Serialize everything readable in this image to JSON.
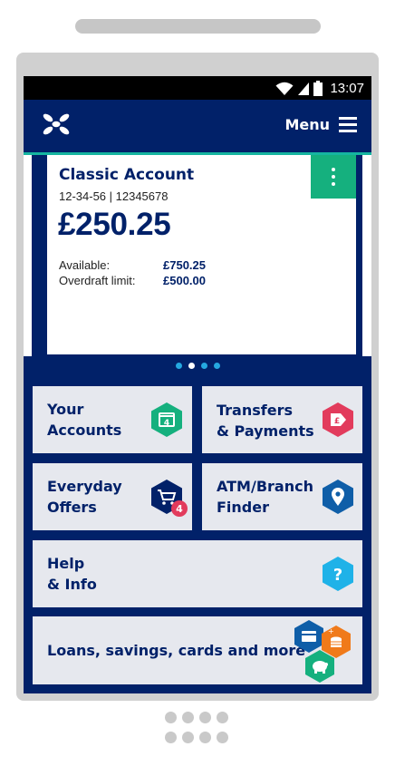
{
  "status_bar": {
    "time": "13:07"
  },
  "header": {
    "menu_label": "Menu"
  },
  "account_card": {
    "name": "Classic Account",
    "sort_and_number": "12-34-56 | 12345678",
    "balance": "£250.25",
    "available_label": "Available:",
    "available_value": "£750.25",
    "overdraft_label": "Overdraft limit:",
    "overdraft_value": "£500.00"
  },
  "carousel": {
    "page_count": 4,
    "active_index": 1
  },
  "tiles": {
    "your_accounts": {
      "label": "Your\nAccounts",
      "badge": "4"
    },
    "transfers": {
      "label": "Transfers\n& Payments"
    },
    "offers": {
      "label": "Everyday\nOffers",
      "badge": "4"
    },
    "atm": {
      "label": "ATM/Branch\nFinder"
    },
    "help": {
      "label": "Help\n& Info"
    },
    "loans": {
      "label": "Loans, savings, cards and more"
    }
  },
  "colors": {
    "navy": "#012169",
    "teal": "#15b5a0",
    "green": "#15b07e",
    "red": "#e23b5c",
    "blue": "#0f5ea8",
    "light_blue": "#1fb2e8",
    "orange": "#f07a1a"
  }
}
